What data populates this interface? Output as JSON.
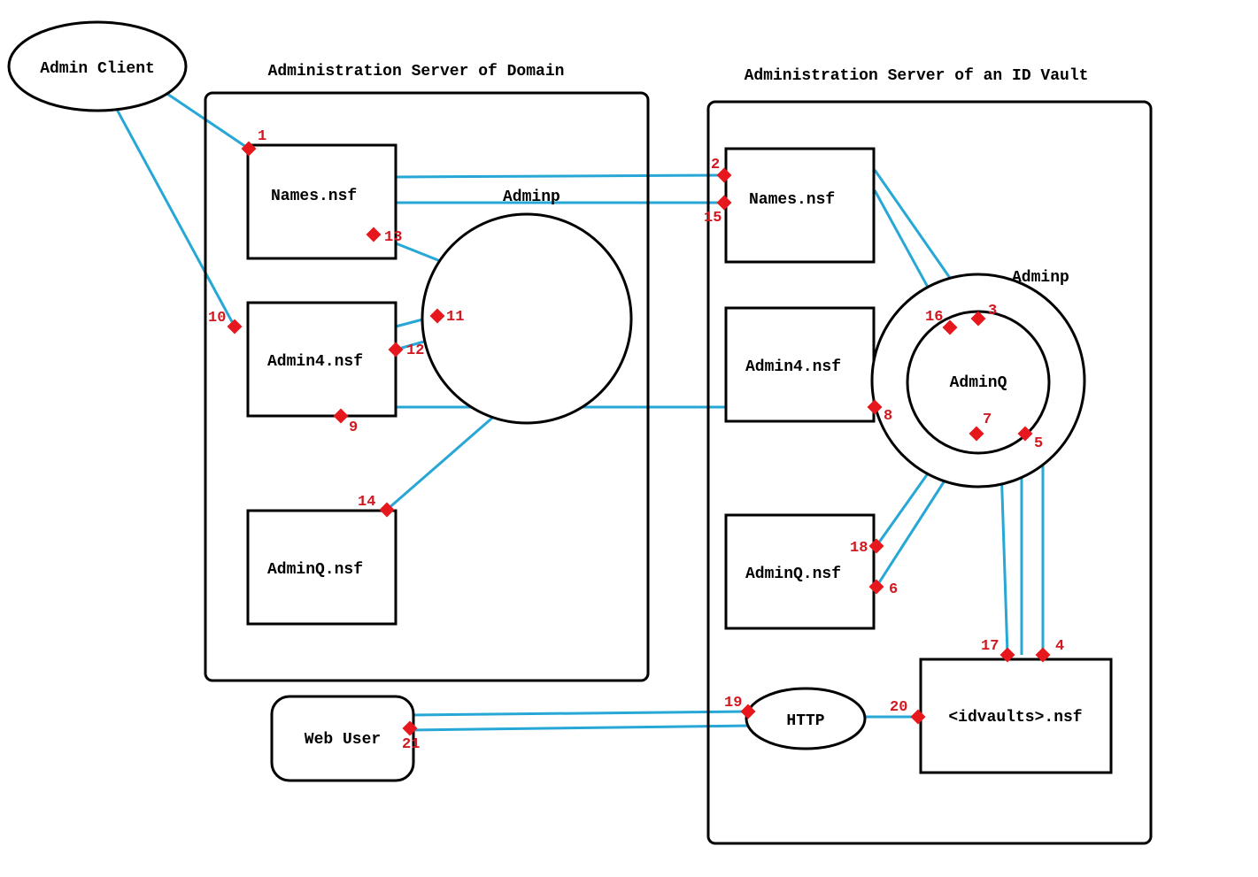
{
  "titles": {
    "domain_server": "Administration Server of Domain",
    "idvault_server": "Administration Server of an ID Vault"
  },
  "nodes": {
    "admin_client": "Admin Client",
    "web_user": "Web User",
    "http": "HTTP",
    "adminp_left": "Adminp",
    "adminp_right": "Adminp",
    "adminq": "AdminQ",
    "names_left": "Names.nsf",
    "admin4_left": "Admin4.nsf",
    "adminq_left": "AdminQ.nsf",
    "names_right": "Names.nsf",
    "admin4_right": "Admin4.nsf",
    "adminq_right": "AdminQ.nsf",
    "idvaults": "<idvaults>.nsf"
  },
  "markers": {
    "m1": "1",
    "m2": "2",
    "m3": "3",
    "m4": "4",
    "m5": "5",
    "m6": "6",
    "m7": "7",
    "m8": "8",
    "m9": "9",
    "m10": "10",
    "m11": "11",
    "m12": "12",
    "m13": "13",
    "m14": "14",
    "m15": "15",
    "m16": "16",
    "m17": "17",
    "m18": "18",
    "m19": "19",
    "m20": "20",
    "m21": "21"
  }
}
